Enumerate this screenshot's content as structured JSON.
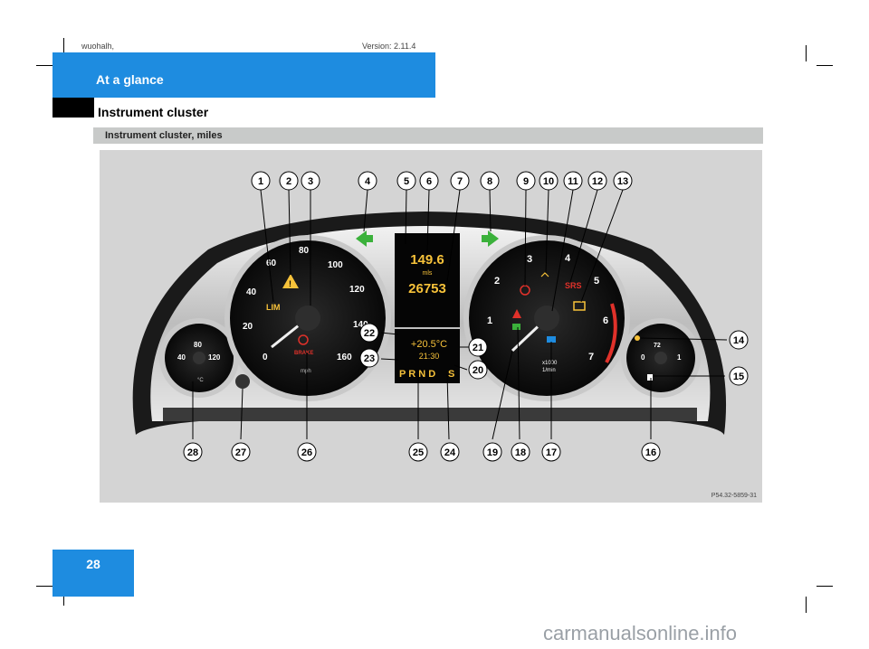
{
  "header": {
    "meta_left": "wuohalh,",
    "meta_right": "Version: 2.11.4",
    "section_title": "At a glance",
    "page_subtitle": "Instrument cluster"
  },
  "figure": {
    "caption": "Instrument cluster, miles",
    "figure_id": "P54.32-5859-31",
    "callouts": [
      "1",
      "2",
      "3",
      "4",
      "5",
      "6",
      "7",
      "8",
      "9",
      "10",
      "11",
      "12",
      "13",
      "14",
      "15",
      "16",
      "17",
      "18",
      "19",
      "20",
      "21",
      "22",
      "23",
      "24",
      "25",
      "26",
      "27",
      "28"
    ],
    "speedo": {
      "ticks": [
        "0",
        "20",
        "40",
        "60",
        "80",
        "100",
        "120",
        "140",
        "160"
      ],
      "lim": "LIM",
      "brake": "BRAKE",
      "unit": "mph"
    },
    "tacho": {
      "ticks": [
        "1",
        "2",
        "3",
        "4",
        "5",
        "6",
        "7"
      ],
      "srs": "SRS",
      "unit_line1": "x1000",
      "unit_line2": "1/min"
    },
    "display": {
      "trip": "149.6",
      "trip_unit": "mls",
      "odometer": "26753",
      "temp": "+20.5°C",
      "time": "21:30",
      "gears": "P R N D",
      "gear_active": "D",
      "program": "S"
    },
    "coolant_gauge": {
      "ticks": [
        "40",
        "80",
        "120"
      ],
      "unit": "°C"
    },
    "fuel_gauge": {
      "ticks": [
        "0",
        "1",
        "72"
      ]
    }
  },
  "footer": {
    "page_number": "28",
    "watermark": "carmanualsonline.info"
  },
  "colors": {
    "header_blue": "#1e8ce0",
    "arrow_green": "#3bb13b",
    "display_amber": "#f7c23a",
    "warning_red": "#e0312a"
  }
}
